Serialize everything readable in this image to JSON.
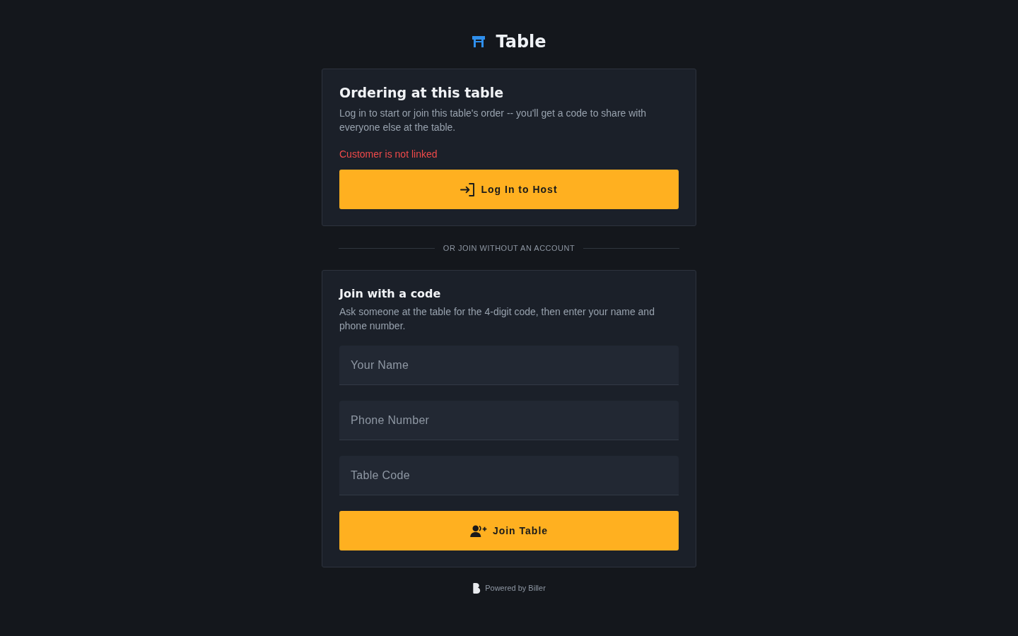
{
  "header": {
    "title": "Table"
  },
  "host_card": {
    "title": "Ordering at this table",
    "description": "Log in to start or join this table's order -- you'll get a code to share with everyone else at the table.",
    "error": "Customer is not linked",
    "button": "Log In to Host"
  },
  "divider": "OR JOIN WITHOUT AN ACCOUNT",
  "join_card": {
    "title": "Join with a code",
    "description": "Ask someone at the table for the 4-digit code, then enter your name and phone number.",
    "fields": [
      {
        "placeholder": "Your Name"
      },
      {
        "placeholder": "Phone Number"
      },
      {
        "placeholder": "Table Code"
      }
    ],
    "button": "Join Table"
  },
  "footer": {
    "text": "Powered by Biller"
  }
}
